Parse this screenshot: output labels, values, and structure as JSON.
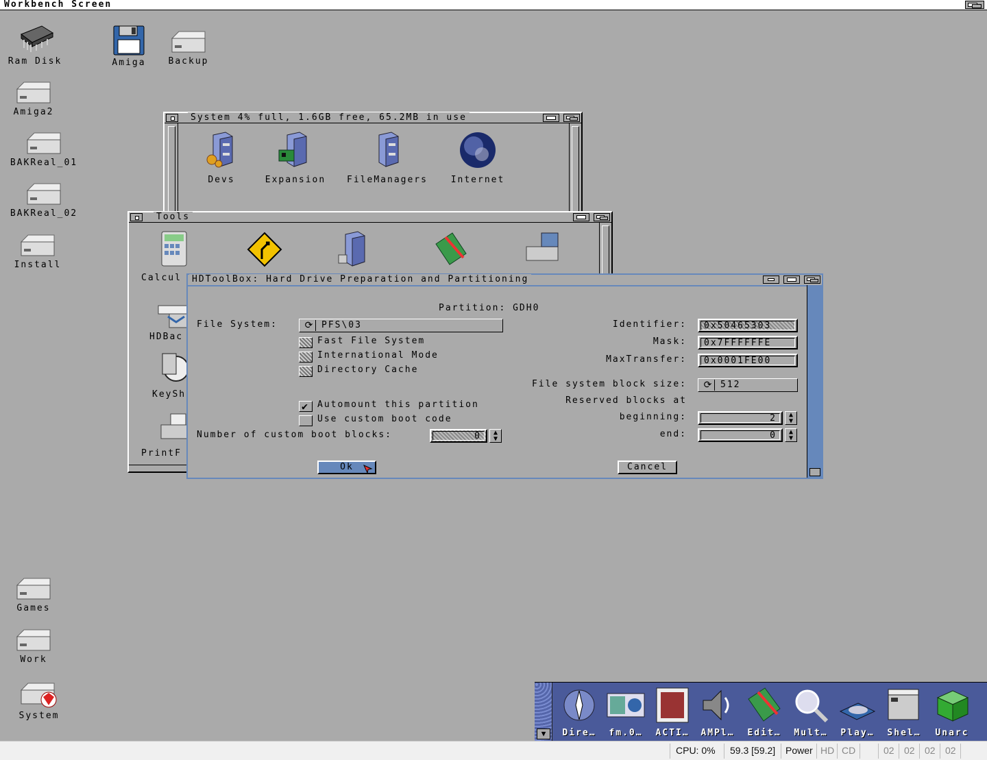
{
  "screen": {
    "title": "Workbench Screen"
  },
  "desktop_icons": [
    {
      "label": "Ram Disk"
    },
    {
      "label": "Amiga"
    },
    {
      "label": "Backup"
    },
    {
      "label": "Amiga2"
    },
    {
      "label": "BAKReal_01"
    },
    {
      "label": "BAKReal_02"
    },
    {
      "label": "Install"
    },
    {
      "label": "Games"
    },
    {
      "label": "Work"
    },
    {
      "label": "System"
    }
  ],
  "system_window": {
    "title": "System  4% full, 1.6GB free, 65.2MB in use",
    "icons": [
      {
        "label": "Devs"
      },
      {
        "label": "Expansion"
      },
      {
        "label": "FileManagers"
      },
      {
        "label": "Internet"
      }
    ]
  },
  "tools_window": {
    "title": "Tools",
    "icons": [
      {
        "label": "Calcul"
      },
      {
        "label": "HDBac"
      },
      {
        "label": "KeySh"
      },
      {
        "label": "PrintF"
      }
    ]
  },
  "hdtoolbox": {
    "title": "HDToolBox: Hard Drive Preparation and Partitioning",
    "partition_label": "Partition: GDH0",
    "file_system_label": "File System:",
    "file_system_value": "PFS\\03",
    "checks": {
      "fast_fs": "Fast File System",
      "intl_mode": "International Mode",
      "dir_cache": "Directory Cache",
      "automount": "Automount this partition",
      "custom_boot": "Use custom boot code"
    },
    "custom_boot_blocks_label": "Number of custom boot blocks:",
    "custom_boot_blocks_value": "0",
    "identifier_label": "Identifier:",
    "identifier_value": "0x50465303",
    "mask_label": "Mask:",
    "mask_value": "0x7FFFFFFE",
    "maxtransfer_label": "MaxTransfer:",
    "maxtransfer_value": "0x0001FE00",
    "blocksize_label": "File system block size:",
    "blocksize_value": "512",
    "reserved_label": "Reserved blocks at",
    "beginning_label": "beginning:",
    "beginning_value": "2",
    "end_label": "end:",
    "end_value": "0",
    "ok_label": "Ok",
    "cancel_label": "Cancel"
  },
  "dock": {
    "items": [
      {
        "label": "Dire…"
      },
      {
        "label": "fm.0…"
      },
      {
        "label": "ACTI…"
      },
      {
        "label": "AMPl…"
      },
      {
        "label": "Edit…"
      },
      {
        "label": "Mult…"
      },
      {
        "label": "Play…"
      },
      {
        "label": "Shel…"
      },
      {
        "label": "Unarc"
      }
    ]
  },
  "statusbar": {
    "cpu": "CPU: 0%",
    "fps": "59.3 [59.2]",
    "power": "Power",
    "hd": "HD",
    "cd": "CD",
    "drives": [
      "02",
      "02",
      "02",
      "02"
    ]
  }
}
